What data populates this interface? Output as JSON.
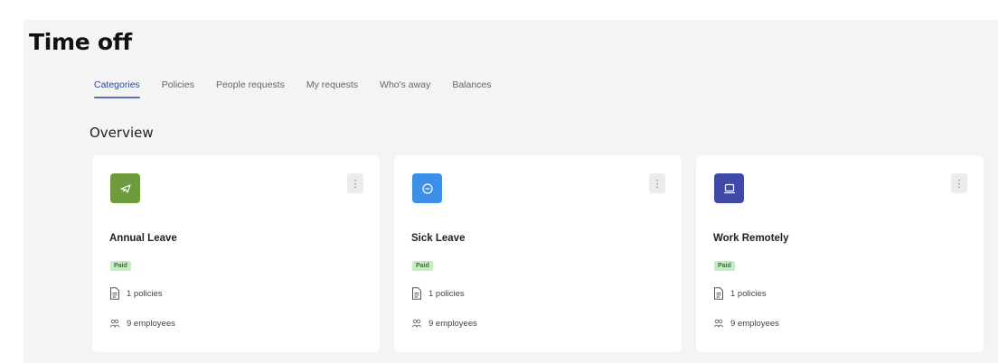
{
  "page": {
    "title": "Time off"
  },
  "tabs": [
    {
      "label": "Categories",
      "active": true
    },
    {
      "label": "Policies",
      "active": false
    },
    {
      "label": "People requests",
      "active": false
    },
    {
      "label": "My requests",
      "active": false
    },
    {
      "label": "Who's away",
      "active": false
    },
    {
      "label": "Balances",
      "active": false
    }
  ],
  "overview": {
    "title": "Overview",
    "cards": [
      {
        "name": "Annual Leave",
        "badge": "Paid",
        "policies": "1 policies",
        "employees": "9 employees",
        "icon": "plane-icon",
        "color": "#6e9b3b"
      },
      {
        "name": "Sick Leave",
        "badge": "Paid",
        "policies": "1 policies",
        "employees": "9 employees",
        "icon": "pill-icon",
        "color": "#3d8fe8"
      },
      {
        "name": "Work Remotely",
        "badge": "Paid",
        "policies": "1 policies",
        "employees": "9 employees",
        "icon": "laptop-icon",
        "color": "#3f49a8"
      }
    ]
  },
  "colors": {
    "accent": "#2f4a92",
    "badge_bg": "#c8ebc6",
    "badge_text": "#2e7a2e"
  }
}
